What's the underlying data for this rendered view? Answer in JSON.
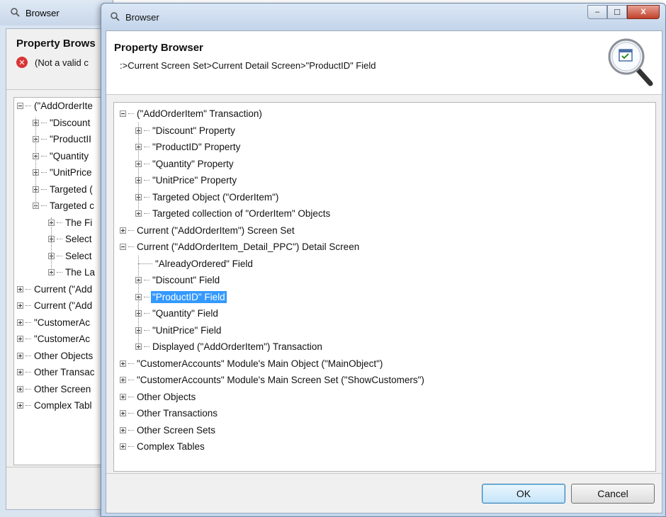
{
  "background_window": {
    "title": "Browser",
    "header_title": "Property Brows",
    "error_text": "(Not a valid c",
    "tree": [
      {
        "label": "(\"AddOrderIte",
        "depth": 0,
        "expander": "minus"
      },
      {
        "label": "\"Discount",
        "depth": 1,
        "expander": "plus"
      },
      {
        "label": "\"ProductII",
        "depth": 1,
        "expander": "plus"
      },
      {
        "label": "\"Quantity",
        "depth": 1,
        "expander": "plus"
      },
      {
        "label": "\"UnitPrice",
        "depth": 1,
        "expander": "plus"
      },
      {
        "label": "Targeted (",
        "depth": 1,
        "expander": "plus"
      },
      {
        "label": "Targeted c",
        "depth": 1,
        "expander": "minus"
      },
      {
        "label": "The Fi",
        "depth": 2,
        "expander": "plus"
      },
      {
        "label": "Select",
        "depth": 2,
        "expander": "plus"
      },
      {
        "label": "Select",
        "depth": 2,
        "expander": "plus"
      },
      {
        "label": "The La",
        "depth": 2,
        "expander": "plus"
      },
      {
        "label": "Current (\"Add",
        "depth": 0,
        "expander": "plus"
      },
      {
        "label": "Current (\"Add",
        "depth": 0,
        "expander": "plus"
      },
      {
        "label": "\"CustomerAc",
        "depth": 0,
        "expander": "plus"
      },
      {
        "label": "\"CustomerAc",
        "depth": 0,
        "expander": "plus"
      },
      {
        "label": "Other Objects",
        "depth": 0,
        "expander": "plus"
      },
      {
        "label": "Other Transac",
        "depth": 0,
        "expander": "plus"
      },
      {
        "label": "Other Screen",
        "depth": 0,
        "expander": "plus"
      },
      {
        "label": "Complex Tabl",
        "depth": 0,
        "expander": "plus"
      }
    ]
  },
  "dialog": {
    "title": "Browser",
    "header_title": "Property Browser",
    "path": ":>Current Screen Set>Current Detail Screen>\"ProductID\" Field",
    "ok_label": "OK",
    "cancel_label": "Cancel",
    "window_buttons": {
      "minimize": "–",
      "maximize": "☐",
      "close": "X"
    },
    "tree": [
      {
        "label": "(\"AddOrderItem\" Transaction)",
        "depth": 0,
        "expander": "minus"
      },
      {
        "label": "\"Discount\" Property",
        "depth": 1,
        "expander": "plus"
      },
      {
        "label": "\"ProductID\" Property",
        "depth": 1,
        "expander": "plus"
      },
      {
        "label": "\"Quantity\" Property",
        "depth": 1,
        "expander": "plus"
      },
      {
        "label": "\"UnitPrice\" Property",
        "depth": 1,
        "expander": "plus"
      },
      {
        "label": "Targeted Object (\"OrderItem\")",
        "depth": 1,
        "expander": "plus"
      },
      {
        "label": "Targeted collection of \"OrderItem\" Objects",
        "depth": 1,
        "expander": "plus"
      },
      {
        "label": "Current (\"AddOrderItem\") Screen Set",
        "depth": 0,
        "expander": "plus"
      },
      {
        "label": "Current (\"AddOrderItem_Detail_PPC\") Detail Screen",
        "depth": 0,
        "expander": "minus"
      },
      {
        "label": "\"AlreadyOrdered\" Field",
        "depth": 1,
        "expander": "none"
      },
      {
        "label": "\"Discount\" Field",
        "depth": 1,
        "expander": "plus"
      },
      {
        "label": "\"ProductID\" Field",
        "depth": 1,
        "expander": "plus",
        "selected": true
      },
      {
        "label": "\"Quantity\" Field",
        "depth": 1,
        "expander": "plus"
      },
      {
        "label": "\"UnitPrice\" Field",
        "depth": 1,
        "expander": "plus"
      },
      {
        "label": "Displayed (\"AddOrderItem\") Transaction",
        "depth": 1,
        "expander": "plus"
      },
      {
        "label": "\"CustomerAccounts\" Module's Main Object (\"MainObject\")",
        "depth": 0,
        "expander": "plus"
      },
      {
        "label": "\"CustomerAccounts\" Module's Main Screen Set (\"ShowCustomers\")",
        "depth": 0,
        "expander": "plus"
      },
      {
        "label": "Other Objects",
        "depth": 0,
        "expander": "plus"
      },
      {
        "label": "Other Transactions",
        "depth": 0,
        "expander": "plus"
      },
      {
        "label": "Other Screen Sets",
        "depth": 0,
        "expander": "plus"
      },
      {
        "label": "Complex Tables",
        "depth": 0,
        "expander": "plus"
      }
    ]
  },
  "colors": {
    "selection": "#3399ff",
    "error": "#d93535",
    "title_bar": "#c4d6ec"
  }
}
